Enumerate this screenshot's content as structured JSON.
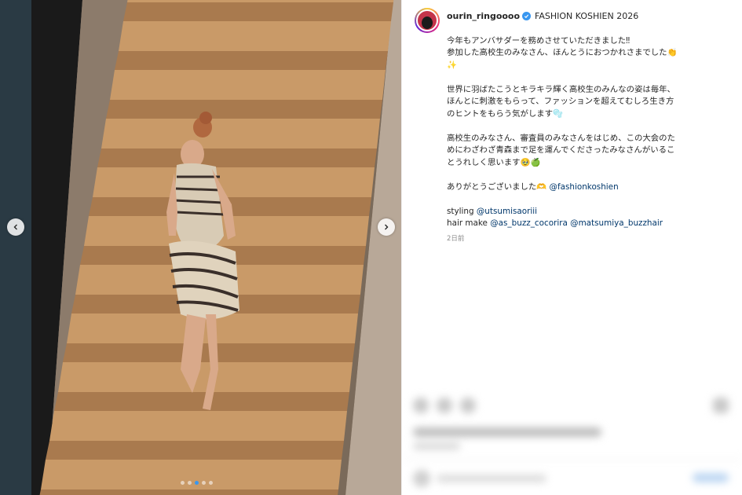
{
  "post": {
    "username": "ourin_ringoooo",
    "location": "FASHION KOSHIEN 2026",
    "caption": {
      "para1": [
        "今年もアンバサダーを務めさせていただきました‼︎",
        "参加した高校生のみなさん、ほんとうにおつかれさまでした👏",
        "✨"
      ],
      "para2": [
        "世界に羽ばたこうとキラキラ輝く高校生のみんなの姿は毎年、",
        "ほんとに刺激をもらって、ファッションを超えてむしろ生き方",
        "のヒントをもらう気がします🫧"
      ],
      "para3": [
        "高校生のみなさん、審査員のみなさんをはじめ、この大会のた",
        "めにわざわざ青森まで足を運んでくださったみなさんがいるこ",
        "とうれしく思います🥹🍏"
      ],
      "thanks": "ありがとうございました🫶",
      "thanks_mention": "@fashionkoshien",
      "styling_label": "styling",
      "styling_mention": "@utsumisaoriii",
      "hair_label": "hair make",
      "hair_mention1": "@as_buzz_cocorira",
      "hair_mention2": "@matsumiya_buzzhair"
    },
    "timestamp": "2日前"
  },
  "carousel": {
    "dot_count": 5,
    "active_index": 2
  },
  "icons": {
    "verified": "verified-badge-icon",
    "prev": "chevron-left-icon",
    "next": "chevron-right-icon"
  },
  "colors": {
    "accent": "#3897f0",
    "mention": "#00376b",
    "muted": "#8e8e8e"
  }
}
